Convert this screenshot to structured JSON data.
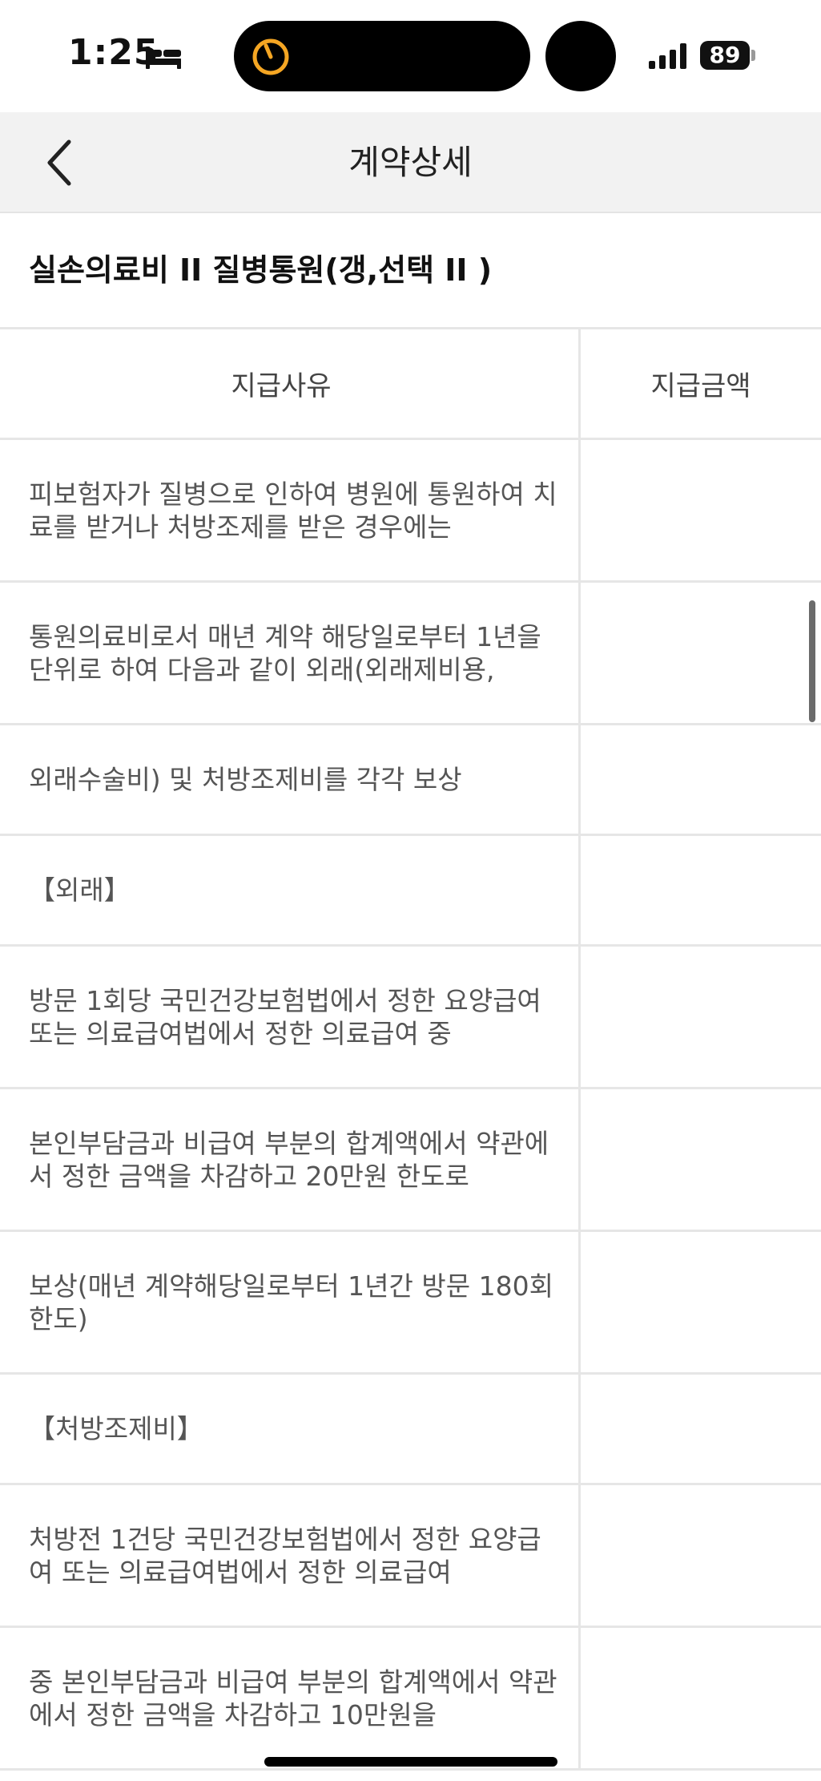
{
  "status_bar": {
    "time": "1:25",
    "battery": "89",
    "icons": [
      "bed-icon",
      "timer-icon",
      "signal-icon",
      "battery-icon"
    ],
    "timer_color": "#f5a623"
  },
  "nav": {
    "back_icon": "chevron-left-icon",
    "title": "계약상세"
  },
  "product": {
    "title": "실손의료비 II 질병통원(갱,선택 II )"
  },
  "table": {
    "headers": {
      "reason": "지급사유",
      "amount": "지급금액"
    },
    "rows": [
      {
        "reason": "피보험자가 질병으로 인하여 병원에 통원하여 치료를 받거나 처방조제를 받은 경우에는",
        "amount": ""
      },
      {
        "reason": "통원의료비로서 매년 계약 해당일로부터 1년을 단위로 하여 다음과 같이 외래(외래제비용,",
        "amount": ""
      },
      {
        "reason": "외래수술비) 및 처방조제비를 각각 보상",
        "amount": ""
      },
      {
        "reason": "【외래】",
        "amount": ""
      },
      {
        "reason": "방문 1회당 국민건강보험법에서 정한 요양급여 또는 의료급여법에서 정한 의료급여 중",
        "amount": ""
      },
      {
        "reason": "본인부담금과 비급여 부분의 합계액에서 약관에서 정한 금액을 차감하고 20만원 한도로",
        "amount": ""
      },
      {
        "reason": "보상(매년 계약해당일로부터 1년간 방문 180회 한도)",
        "amount": ""
      },
      {
        "reason": "【처방조제비】",
        "amount": ""
      },
      {
        "reason": "처방전 1건당 국민건강보험법에서 정한 요양급여 또는 의료급여법에서 정한 의료급여",
        "amount": ""
      },
      {
        "reason": "중 본인부담금과 비급여 부분의 합계액에서 약관에서 정한 금액을 차감하고 10만원을",
        "amount": ""
      }
    ]
  },
  "colors": {
    "nav_background": "#f2f2f2",
    "divider": "#e6e6e6",
    "body_text": "#555555"
  }
}
